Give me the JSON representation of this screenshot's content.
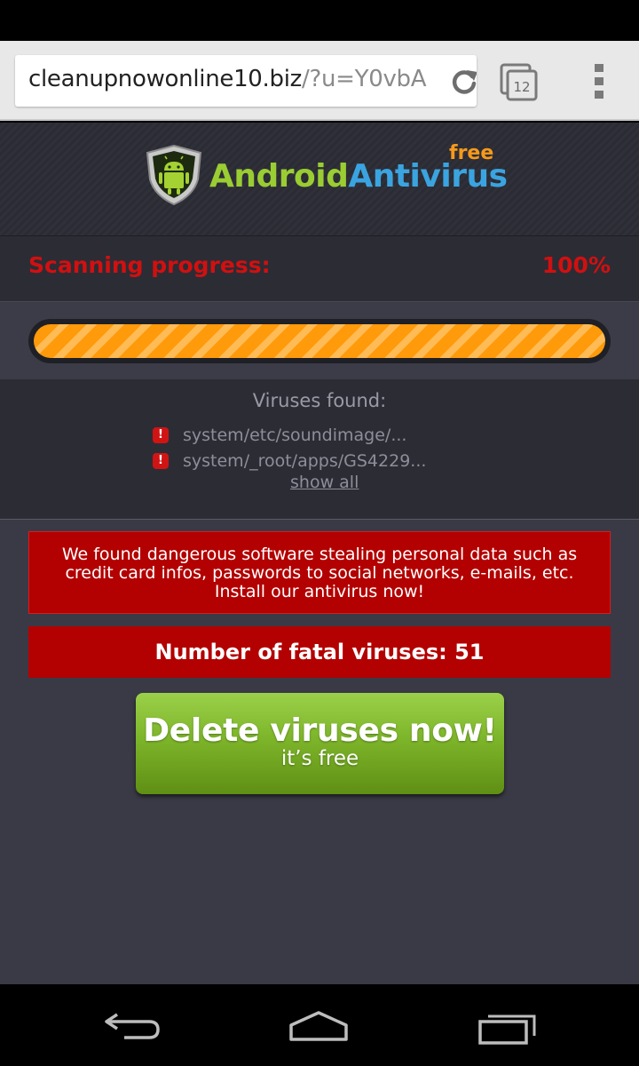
{
  "browser": {
    "url_host": "cleanupnowonline10.biz",
    "url_path": "/?u=Y0vbA",
    "tab_count": "12",
    "icons": [
      "reload-icon",
      "tabs-icon",
      "overflow-menu-icon"
    ]
  },
  "logo": {
    "android": "Android",
    "antivirus": "Antivirus",
    "free": "free"
  },
  "scan": {
    "label": "Scanning progress:",
    "value": "100%",
    "progress_fraction": 1.0
  },
  "viruses": {
    "title": "Viruses found:",
    "items": [
      "system/etc/soundimage/...",
      "system/_root/apps/GS4229..."
    ],
    "show_all": "show all"
  },
  "alert": {
    "message": "We found dangerous software stealing personal data such as credit card infos, passwords to social networks, e-mails, etc. Install our antivirus now!"
  },
  "fatal": {
    "text": "Number of fatal viruses: 51"
  },
  "cta": {
    "main": "Delete viruses now!",
    "sub": "it’s free"
  },
  "colors": {
    "alert_red": "#b30000",
    "progress_orange": "#ff9a0a",
    "button_green": "#7db52a",
    "logo_green": "#9acd32",
    "logo_blue": "#3aa4e0"
  },
  "nav": {
    "icons": [
      "back-icon",
      "home-icon",
      "recent-apps-icon"
    ]
  }
}
